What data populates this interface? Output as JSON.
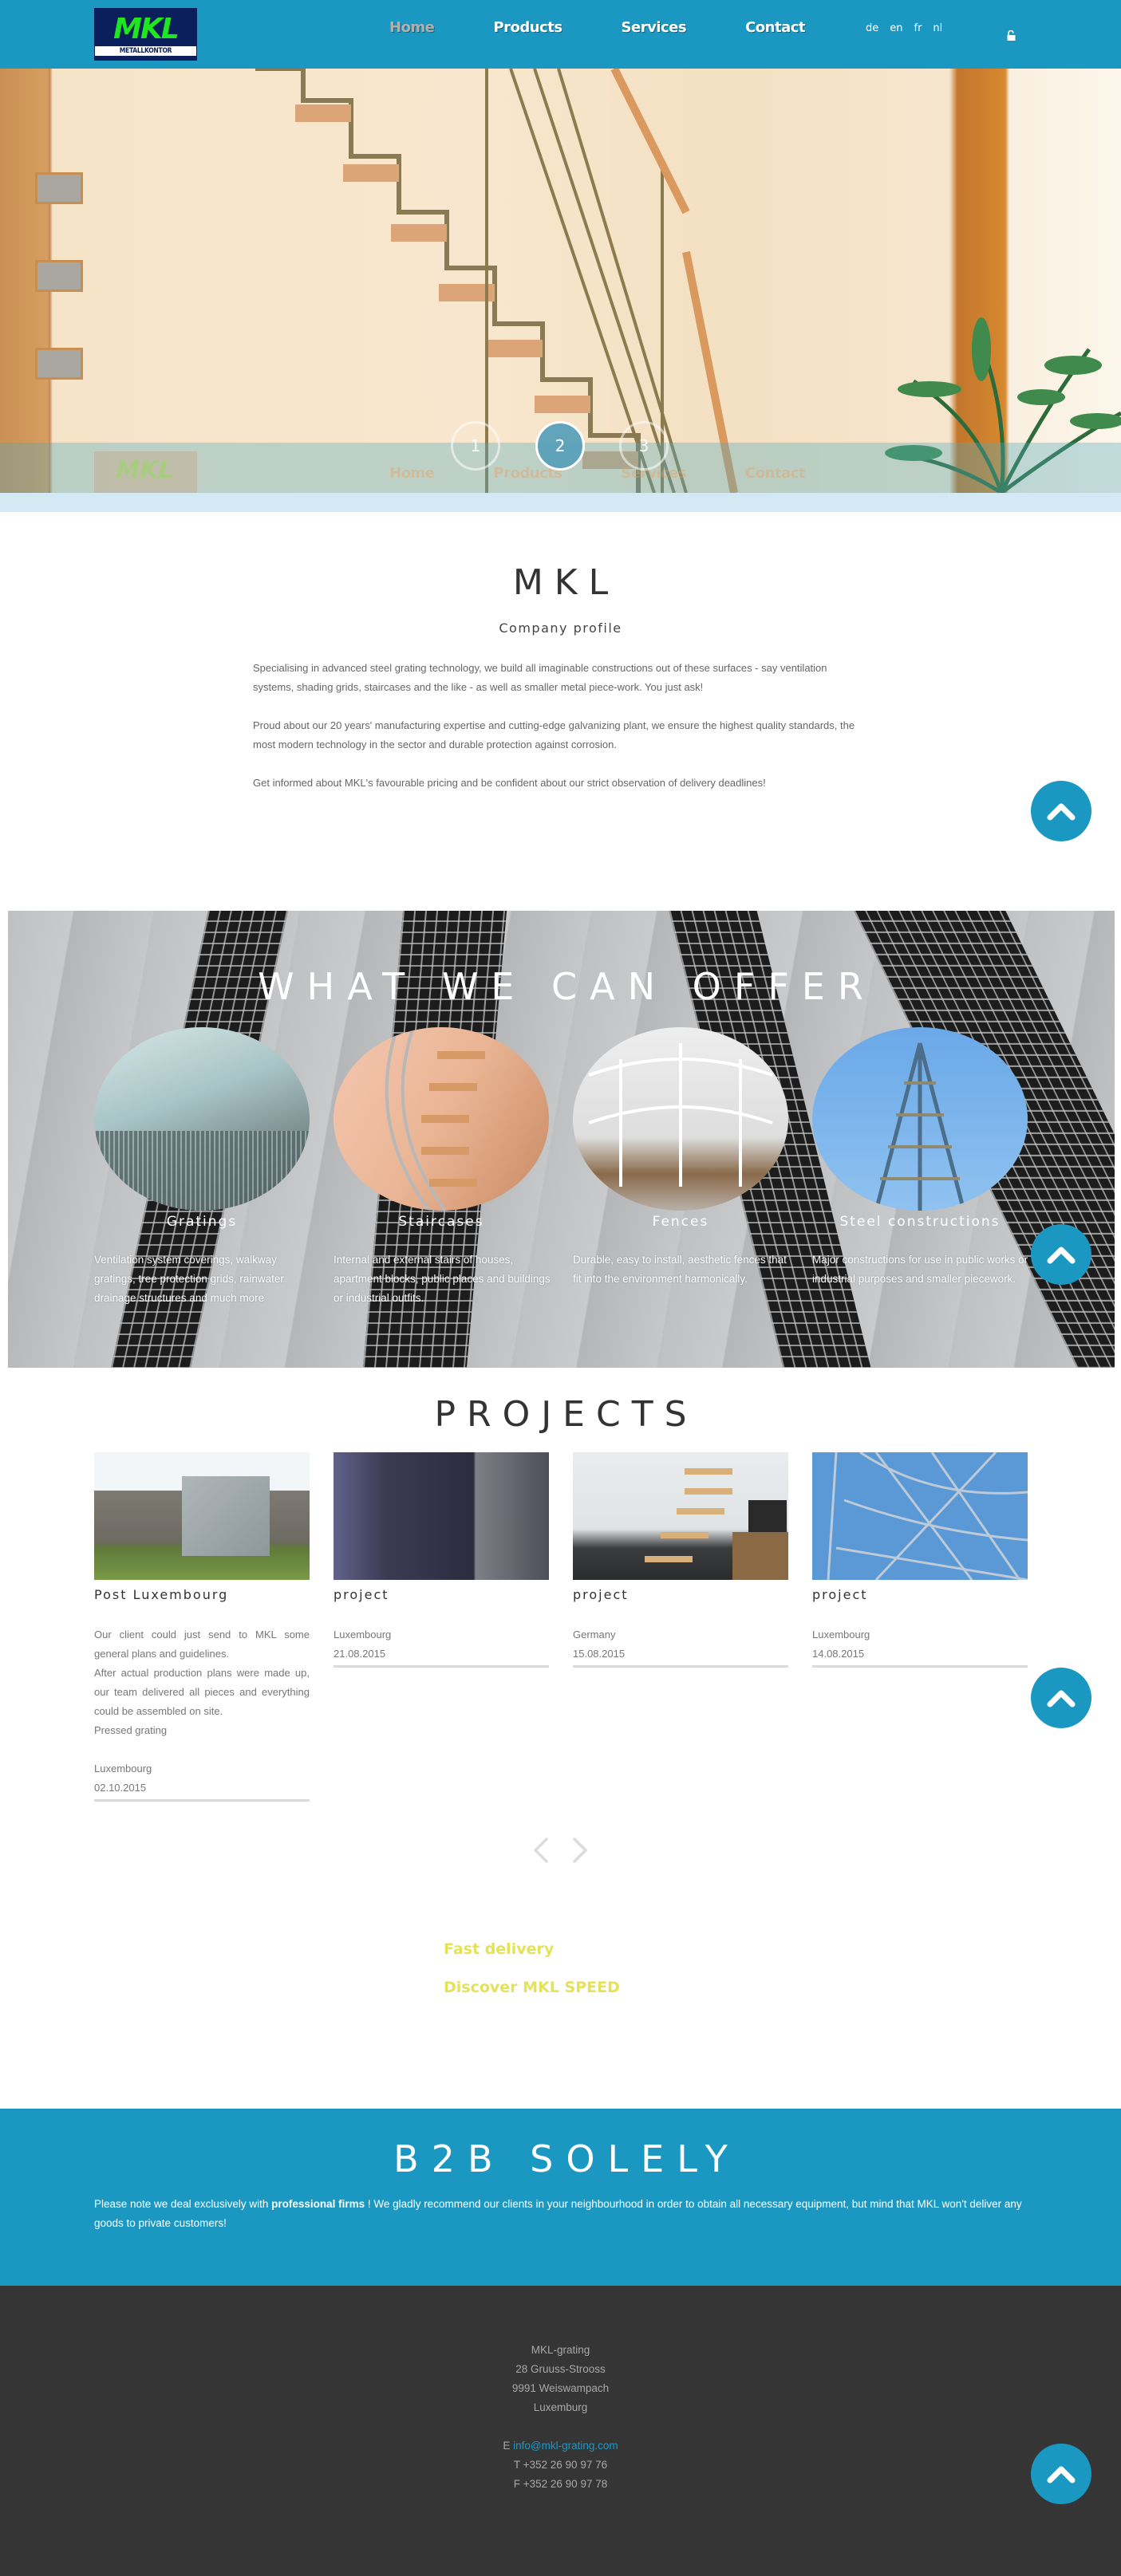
{
  "header": {
    "logo_text": "MKL",
    "logo_subtext": "METALLKONTOR",
    "nav": [
      {
        "label": "Home",
        "active": true
      },
      {
        "label": "Products",
        "active": false
      },
      {
        "label": "Services",
        "active": false
      },
      {
        "label": "Contact",
        "active": false
      }
    ],
    "languages": [
      "de",
      "en",
      "fr",
      "nl"
    ],
    "lock_icon": "unlocked-padlock-icon"
  },
  "hero": {
    "slides": [
      "1",
      "2",
      "3"
    ],
    "active_slide": 2
  },
  "profile": {
    "title": "MKL",
    "subtitle": "Company profile",
    "paragraphs": [
      "Specialising in advanced steel grating technology, we build all imaginable constructions out of these surfaces - say ventilation systems, shading grids, staircases and the like - as well as smaller metal piece-work. You just ask!",
      "Proud about our 20 years' manufacturing expertise and cutting-edge galvanizing plant, we ensure the highest quality standards, the most modern technology in the sector and durable protection against corrosion.",
      "Get informed about MKL's favourable pricing and be confident about our strict observation of delivery deadlines!"
    ]
  },
  "offer": {
    "title": "WHAT WE CAN OFFER",
    "items": [
      {
        "name": "Gratings",
        "description": "Ventilation system coverings, walkway gratings, tree protection grids, rainwater drainage structures and much more"
      },
      {
        "name": "Staircases",
        "description": "Internal and external stairs of houses, apartment blocks, public places and buildings or industrial outfits."
      },
      {
        "name": "Fences",
        "description": "Durable, easy to install, aesthetic fences that fit into the environment harmonically."
      },
      {
        "name": "Steel constructions",
        "description": "Major constructions for use in public works or industrial purposes and smaller piecework."
      }
    ]
  },
  "projects": {
    "title": "PROJECTS",
    "items": [
      {
        "title": "Post Luxembourg",
        "description": [
          "Our client could just send to MKL some general plans and guidelines.",
          "After actual production plans were made up, our team delivered all pieces and everything could be assembled on site.",
          "Pressed grating"
        ],
        "location": "Luxembourg",
        "date": "02.10.2015"
      },
      {
        "title": "project",
        "description": [],
        "location": "Luxembourg",
        "date": "21.08.2015"
      },
      {
        "title": "project",
        "description": [],
        "location": "Germany",
        "date": "15.08.2015"
      },
      {
        "title": "project",
        "description": [],
        "location": "Luxembourg",
        "date": "14.08.2015"
      }
    ],
    "prev_icon": "chevron-left-icon",
    "next_icon": "chevron-right-icon"
  },
  "promo": {
    "link1": "Fast delivery",
    "link2": "Discover MKL SPEED"
  },
  "b2b": {
    "title": "B2B SOLELY",
    "text_before": "Please note we deal exclusively with ",
    "text_bold": "professional firms",
    "text_after": " ! We gladly recommend our clients in your neighbourhood in order to obtain all necessary equipment, but mind that MKL won't deliver any goods to private customers!"
  },
  "footer": {
    "company": "MKL-grating",
    "street": "28 Gruuss-Strooss",
    "city": "9991 Weiswampach",
    "country": "Luxemburg",
    "email_prefix": "E ",
    "email": "info@mkl-grating.com",
    "phone": "T +352 26 90 97 76",
    "fax": "F +352 26 90 97 78"
  },
  "colors": {
    "brand_blue": "#1a98c2",
    "accent_yellow": "#e4e257",
    "footer_bg": "#353535",
    "logo_green": "#1fe61f",
    "logo_navy": "#0b1f5c"
  }
}
